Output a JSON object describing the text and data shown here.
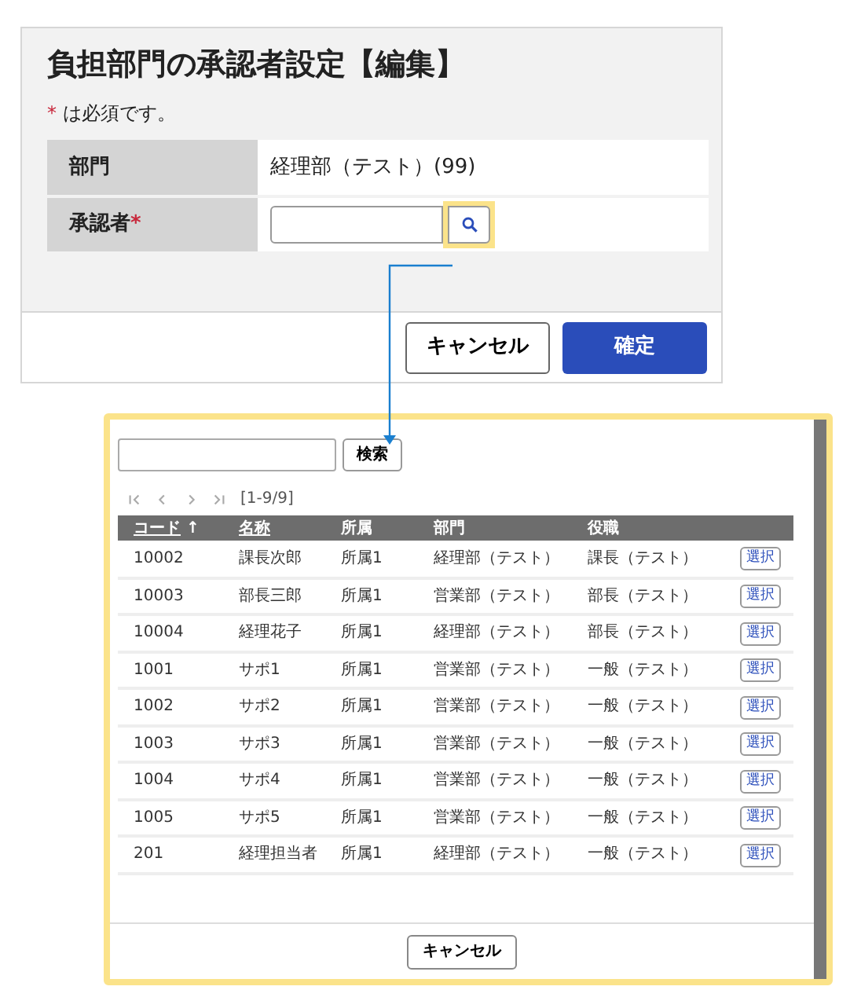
{
  "form": {
    "title": "負担部門の承認者設定【編集】",
    "required_note": {
      "mark": "*",
      "text": "は必須です。"
    },
    "fields": [
      {
        "label": "部門",
        "kind": "text",
        "value": "経理部（テスト）(99)"
      },
      {
        "label": "承認者",
        "kind": "lookup",
        "required_mark": "*",
        "lookup_highlighted": true
      }
    ],
    "buttons": [
      {
        "label": "キャンセル",
        "kind": "secondary"
      },
      {
        "label": "確定",
        "kind": "primary"
      }
    ]
  },
  "picker": {
    "search_button": "検索",
    "pager": {
      "disabled": true,
      "range": "[1-9/9]"
    },
    "columns": [
      {
        "label": "コード",
        "sortable": true,
        "sort_arrow": "↑"
      },
      {
        "label": "名称",
        "sortable": true
      },
      {
        "label": "所属",
        "sortable": false
      },
      {
        "label": "部門",
        "sortable": false
      },
      {
        "label": "役職",
        "sortable": false
      }
    ],
    "rows": [
      {
        "cells": [
          "10002",
          "課長次郎",
          "所属1",
          "経理部（テスト）",
          "課長（テスト）"
        ],
        "action": "選択"
      },
      {
        "cells": [
          "10003",
          "部長三郎",
          "所属1",
          "営業部（テスト）",
          "部長（テスト）"
        ],
        "action": "選択"
      },
      {
        "cells": [
          "10004",
          "経理花子",
          "所属1",
          "経理部（テスト）",
          "部長（テスト）"
        ],
        "action": "選択"
      },
      {
        "cells": [
          "1001",
          "サポ1",
          "所属1",
          "営業部（テスト）",
          "一般（テスト）"
        ],
        "action": "選択"
      },
      {
        "cells": [
          "1002",
          "サポ2",
          "所属1",
          "営業部（テスト）",
          "一般（テスト）"
        ],
        "action": "選択"
      },
      {
        "cells": [
          "1003",
          "サポ3",
          "所属1",
          "営業部（テスト）",
          "一般（テスト）"
        ],
        "action": "選択"
      },
      {
        "cells": [
          "1004",
          "サポ4",
          "所属1",
          "営業部（テスト）",
          "一般（テスト）"
        ],
        "action": "選択"
      },
      {
        "cells": [
          "1005",
          "サポ5",
          "所属1",
          "営業部（テスト）",
          "一般（テスト）"
        ],
        "action": "選択"
      },
      {
        "cells": [
          "201",
          "経理担当者",
          "所属1",
          "経理部（テスト）",
          "一般（テスト）"
        ],
        "action": "選択"
      }
    ],
    "cancel_button": "キャンセル"
  }
}
